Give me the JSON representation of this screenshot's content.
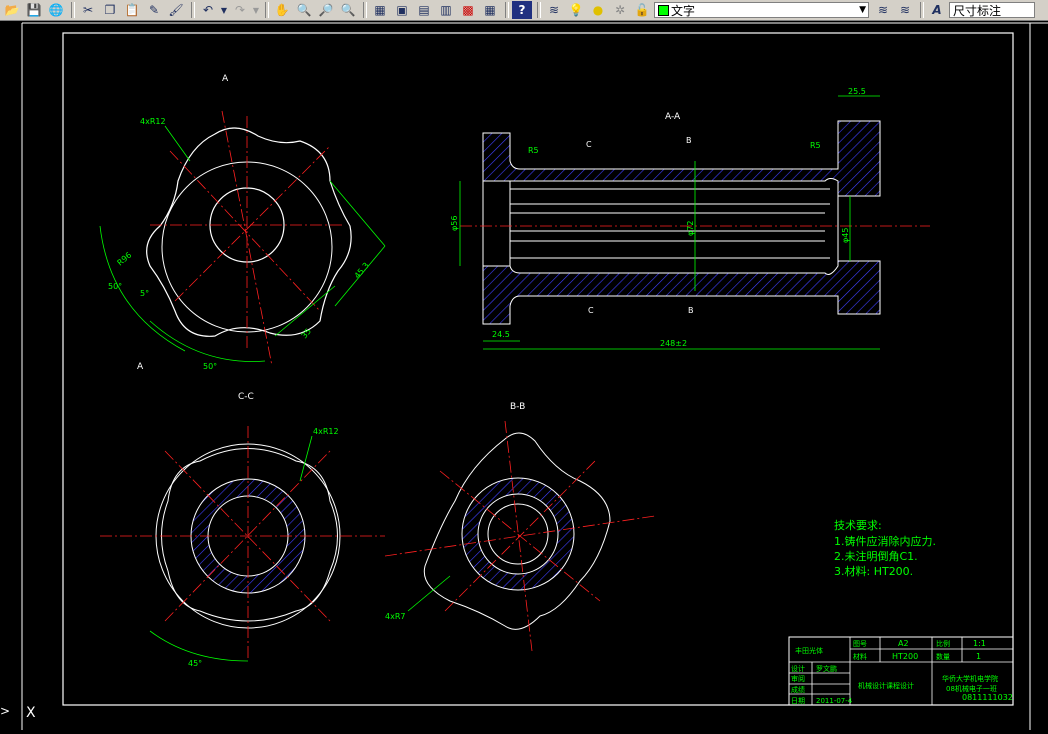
{
  "toolbar": {
    "buttons_a": [
      "open-icon",
      "save-icon",
      "globe-icon"
    ],
    "buttons_b": [
      "cut-icon",
      "copy-icon",
      "paste-icon",
      "brush-icon",
      "match-icon"
    ],
    "buttons_c": [
      "pan-icon",
      "zoom-realtime-icon",
      "zoom-window-icon",
      "zoom-previous-icon"
    ],
    "buttons_d": [
      "properties-icon",
      "design-center-icon",
      "tool-palette-icon",
      "sheet-icon",
      "markup-icon",
      "calculator-icon"
    ],
    "help_icon": "help-icon",
    "layer_combo_value": "文字",
    "dimstyle_combo_value": "尺寸标注",
    "layer_color": "#00ff00"
  },
  "drawing": {
    "colors": {
      "outline": "#ffffff",
      "center": "#ff2020",
      "dimension": "#00ff00",
      "hatch": "#3030a0",
      "hidden": "#2020ff",
      "border": "#ffffff"
    },
    "views": {
      "front_label_a1": "A",
      "front_label_a2": "A",
      "section_aa": "A-A",
      "section_cc": "C-C",
      "section_bb": "B-B",
      "cut_c1": "C",
      "cut_c2": "C",
      "cut_b1": "B",
      "cut_b2": "B"
    },
    "dims": {
      "r12_front": "4xR12",
      "r96": "R96",
      "a50": "50°",
      "a5": "5°",
      "a50b": "50°",
      "d453": "45.3",
      "d35": "35",
      "d255": "25.5",
      "r5a": "R5",
      "r5b": "R5",
      "phi56": "φ56",
      "phi72": "φ72",
      "phi45": "φ45",
      "d245": "24.5",
      "d248": "248±2",
      "r12_cc": "4xR12",
      "a45": "45°",
      "r7": "4xR7"
    },
    "notes": {
      "title": "技术要求:",
      "line1": "1.铸件应消除内应力.",
      "line2": "2.未注明倒角C1.",
      "line3": "3.材料: HT200."
    },
    "titleblock": {
      "part": "丰田光体",
      "drawing_no_label": "图号",
      "drawing_no": "A2",
      "material_label": "材料",
      "material": "HT200",
      "scale_label": "比例",
      "scale": "1:1",
      "qty_label": "数量",
      "qty": "1",
      "designer_label": "设计",
      "designer": "罗文鹏",
      "review_label": "审阅",
      "score_label": "成绩",
      "date_label": "日期",
      "date": "2011-07-4",
      "course": "机械设计课程设计",
      "school": "华侨大学机电学院",
      "class": "08机械电子一班",
      "student_id": "0811111032"
    },
    "ucs_label": "X"
  }
}
